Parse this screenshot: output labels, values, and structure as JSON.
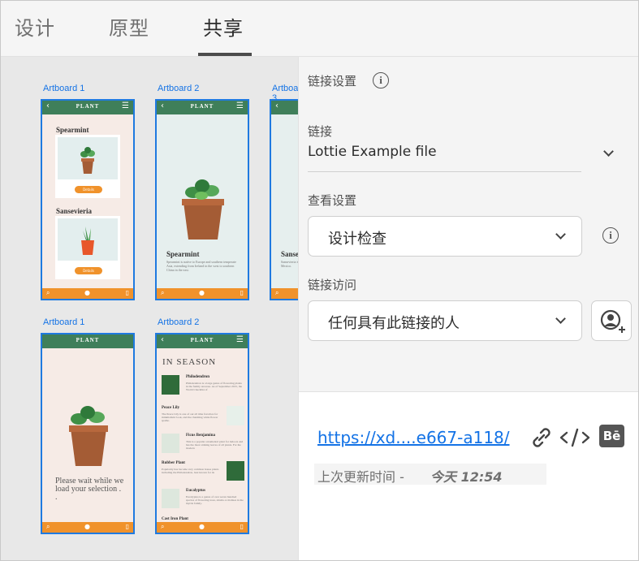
{
  "tabs": [
    {
      "label": "设计",
      "active": false
    },
    {
      "label": "原型",
      "active": false
    },
    {
      "label": "共享",
      "active": true
    }
  ],
  "artboards": {
    "row1": [
      "Artboard 1",
      "Artboard 2",
      "Artboard 3"
    ],
    "row2": [
      "Artboard 1",
      "Artboard 2"
    ],
    "app_brand": "PLANT",
    "ab1": {
      "plant1": "Spearmint",
      "plant2": "Sansevieria",
      "details": "Details"
    },
    "ab2": {
      "title": "Spearmint",
      "desc": "Spearmint is native to Europe and southern temperate Asia, extending from Ireland in the west to southern China in the east."
    },
    "ab3": {
      "title": "Sanse",
      "desc": "Sansevieria is a genus of flowering plants notably Mexico."
    },
    "ab4": {
      "loading": "Please wait while we load your selection . ."
    },
    "ab5": {
      "heading": "IN SEASON",
      "items": [
        {
          "name": "Philodendron",
          "desc": "Philodendron is a large genus of flowering plants in the family Araceae. As of September 2015, the World Checklist of"
        },
        {
          "name": "Peace Lily",
          "desc": "The Peace Lily is one of our all time favorites for minimalistic look, and the charming white flower spathe."
        },
        {
          "name": "Ficus Benjamina",
          "desc": "This is a popular ornamental plant for indoors and has the most striking leaves of all plants. For the modern"
        },
        {
          "name": "Rubber Plant",
          "desc": "Popularity has become very common house plants including the Philodendron, best known for its"
        },
        {
          "name": "Eucalyptus",
          "desc": "Eucalyptus is a genus of over seven hundred species of flowering trees, shrubs or mallees in the myrtle family."
        },
        {
          "name": "Cast Iron Plant",
          "desc": ""
        }
      ]
    }
  },
  "panel": {
    "section_title": "链接设置",
    "link_label": "链接",
    "link_value": "Lottie Example file",
    "view_label": "查看设置",
    "view_value": "设计检查",
    "access_label": "链接访问",
    "access_value": "任何具有此链接的人"
  },
  "share": {
    "url": "https://xd....e667-a118/",
    "updated_prefix": "上次更新时间 -",
    "updated_time": "今天 12:54",
    "behance_label": "Bē"
  },
  "colors": {
    "accent": "#1473e6",
    "artboard_bar": "#3f7f5a",
    "artboard_footer": "#f0922b",
    "artboard_bg": "#f6ebe6"
  }
}
